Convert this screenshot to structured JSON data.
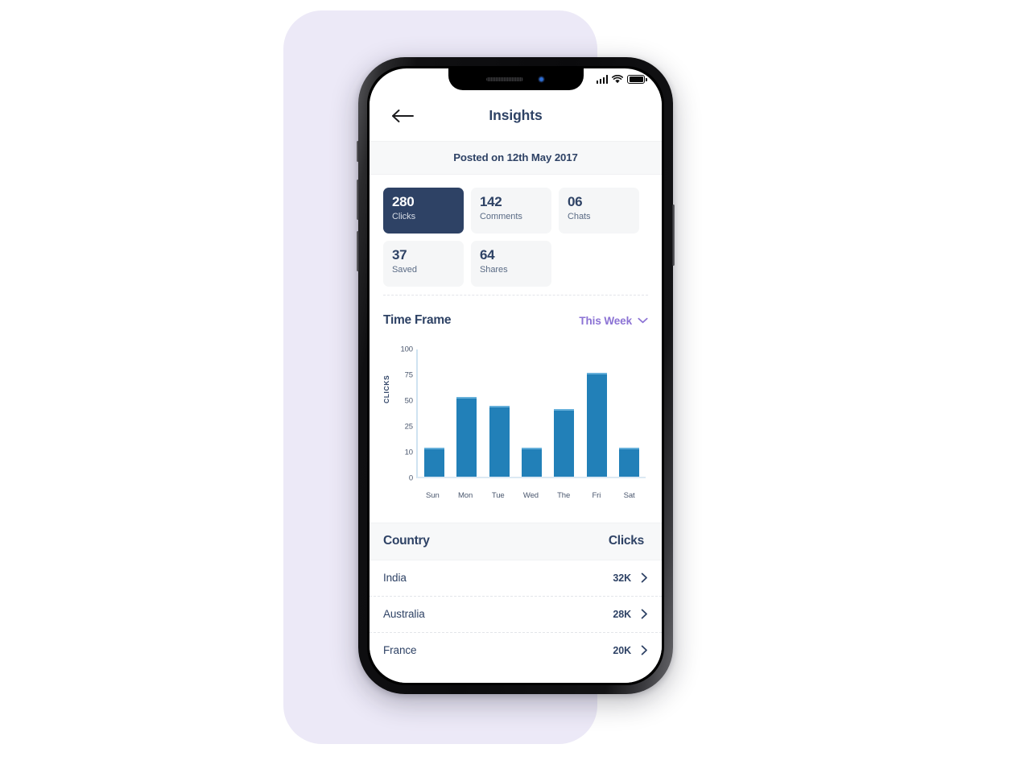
{
  "statusbar": {
    "signal_icon": "signal-bars-icon",
    "wifi_icon": "wifi-icon",
    "battery_icon": "battery-icon"
  },
  "nav": {
    "back_icon": "arrow-left-icon",
    "title": "Insights"
  },
  "posted": {
    "text": "Posted on 12th May 2017"
  },
  "stats": [
    {
      "value": "280",
      "label": "Clicks",
      "active": true
    },
    {
      "value": "142",
      "label": "Comments",
      "active": false
    },
    {
      "value": "06",
      "label": "Chats",
      "active": false
    },
    {
      "value": "37",
      "label": "Saved",
      "active": false
    },
    {
      "value": "64",
      "label": "Shares",
      "active": false
    }
  ],
  "time_frame": {
    "title": "Time Frame",
    "selected": "This Week",
    "chevron_icon": "chevron-down-icon",
    "options": [
      "This Week"
    ]
  },
  "chart_data": {
    "type": "bar",
    "title": "",
    "xlabel": "",
    "ylabel": "CLICKS",
    "categories": [
      "Sun",
      "Mon",
      "Tue",
      "Wed",
      "The",
      "Fri",
      "Sat"
    ],
    "values": [
      12,
      52,
      44,
      12,
      41,
      76,
      12
    ],
    "ytick_labels": [
      "100",
      "75",
      "50",
      "25",
      "10",
      "0"
    ],
    "ytick_values": [
      100,
      75,
      50,
      25,
      10,
      0
    ],
    "ylim": [
      0,
      105
    ],
    "grid": false,
    "legend": false,
    "bar_color": "#2280b8",
    "bar_top_color": "#66b0da",
    "axis_color": "#cfe3f1"
  },
  "country_table": {
    "columns": [
      "Country",
      "Clicks"
    ],
    "chevron_icon": "chevron-right-icon",
    "rows": [
      {
        "country": "India",
        "clicks": "32K"
      },
      {
        "country": "Australia",
        "clicks": "28K"
      },
      {
        "country": "France",
        "clicks": "20K"
      }
    ]
  },
  "theme": {
    "navy": "#2e4265",
    "purple": "#8b72d4",
    "bar_blue": "#2280b8",
    "panel_lavender": "#ece9f7",
    "card_grey": "#f5f6f7"
  }
}
